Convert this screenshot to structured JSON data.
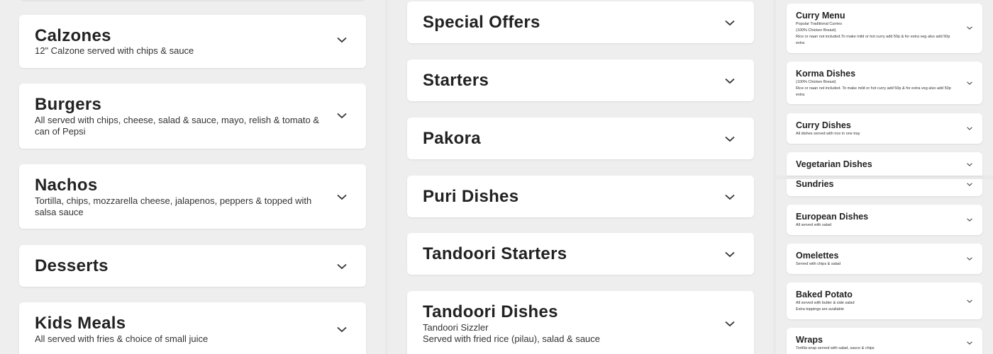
{
  "left_column": {
    "items": [
      {
        "title": "Calzones",
        "desc": "12\" Calzone served with chips & sauce"
      },
      {
        "title": "Burgers",
        "desc": "All served with chips, cheese, salad & sauce, mayo, relish & tomato & can of Pepsi"
      },
      {
        "title": "Nachos",
        "desc": "Tortilla, chips, mozzarella cheese, jalapenos, peppers & topped with salsa sauce"
      },
      {
        "title": "Desserts"
      },
      {
        "title": "Kids Meals",
        "desc": "All served with fries & choice of small juice"
      }
    ]
  },
  "middle_column": {
    "items": [
      {
        "title": "Special Offers"
      },
      {
        "title": "Starters"
      },
      {
        "title": "Pakora"
      },
      {
        "title": "Puri Dishes"
      },
      {
        "title": "Tandoori Starters"
      },
      {
        "title": "Tandoori Dishes",
        "desc_line1": "Tandoori Sizzler",
        "desc_line2": "Served with fried rice (pilau), salad & sauce"
      }
    ]
  },
  "right_column": {
    "items": [
      {
        "title": "Curry Menu",
        "desc_line1": "Popular Traditional Curries",
        "desc_line2": "(100% Chicken Breast)",
        "desc_line3": "Rice or naan not included.To make mild or hot curry add 50p & for extra veg also add 50p extra"
      },
      {
        "title": "Korma Dishes",
        "desc_line1": "(100% Chicken Breast)",
        "desc_line2": "Rice or naan not included. To make mild or hot curry add 50p & for extra veg also add 50p extra"
      },
      {
        "title": "Curry Dishes",
        "desc_line1": "All dishes served with rice in one tray"
      },
      {
        "title": "Vegetarian Dishes"
      },
      {
        "title": "Sundries"
      },
      {
        "title": "European Dishes",
        "desc_line1": "All served with salad"
      },
      {
        "title": "Omelettes",
        "desc_line1": "Served with chips & salad"
      },
      {
        "title": "Baked Potato",
        "desc_line1": "All served with butter & side salad",
        "desc_line2": "Extra toppings are available"
      },
      {
        "title": "Wraps",
        "desc_line1": "Tortilla wrap served with salad, sauce & chips"
      }
    ]
  },
  "icons": {
    "expand": "chevron-down-icon"
  },
  "colors": {
    "background": "#eeeeee",
    "card": "#ffffff",
    "text": "#1f1f1f",
    "chevron": "#333333"
  }
}
